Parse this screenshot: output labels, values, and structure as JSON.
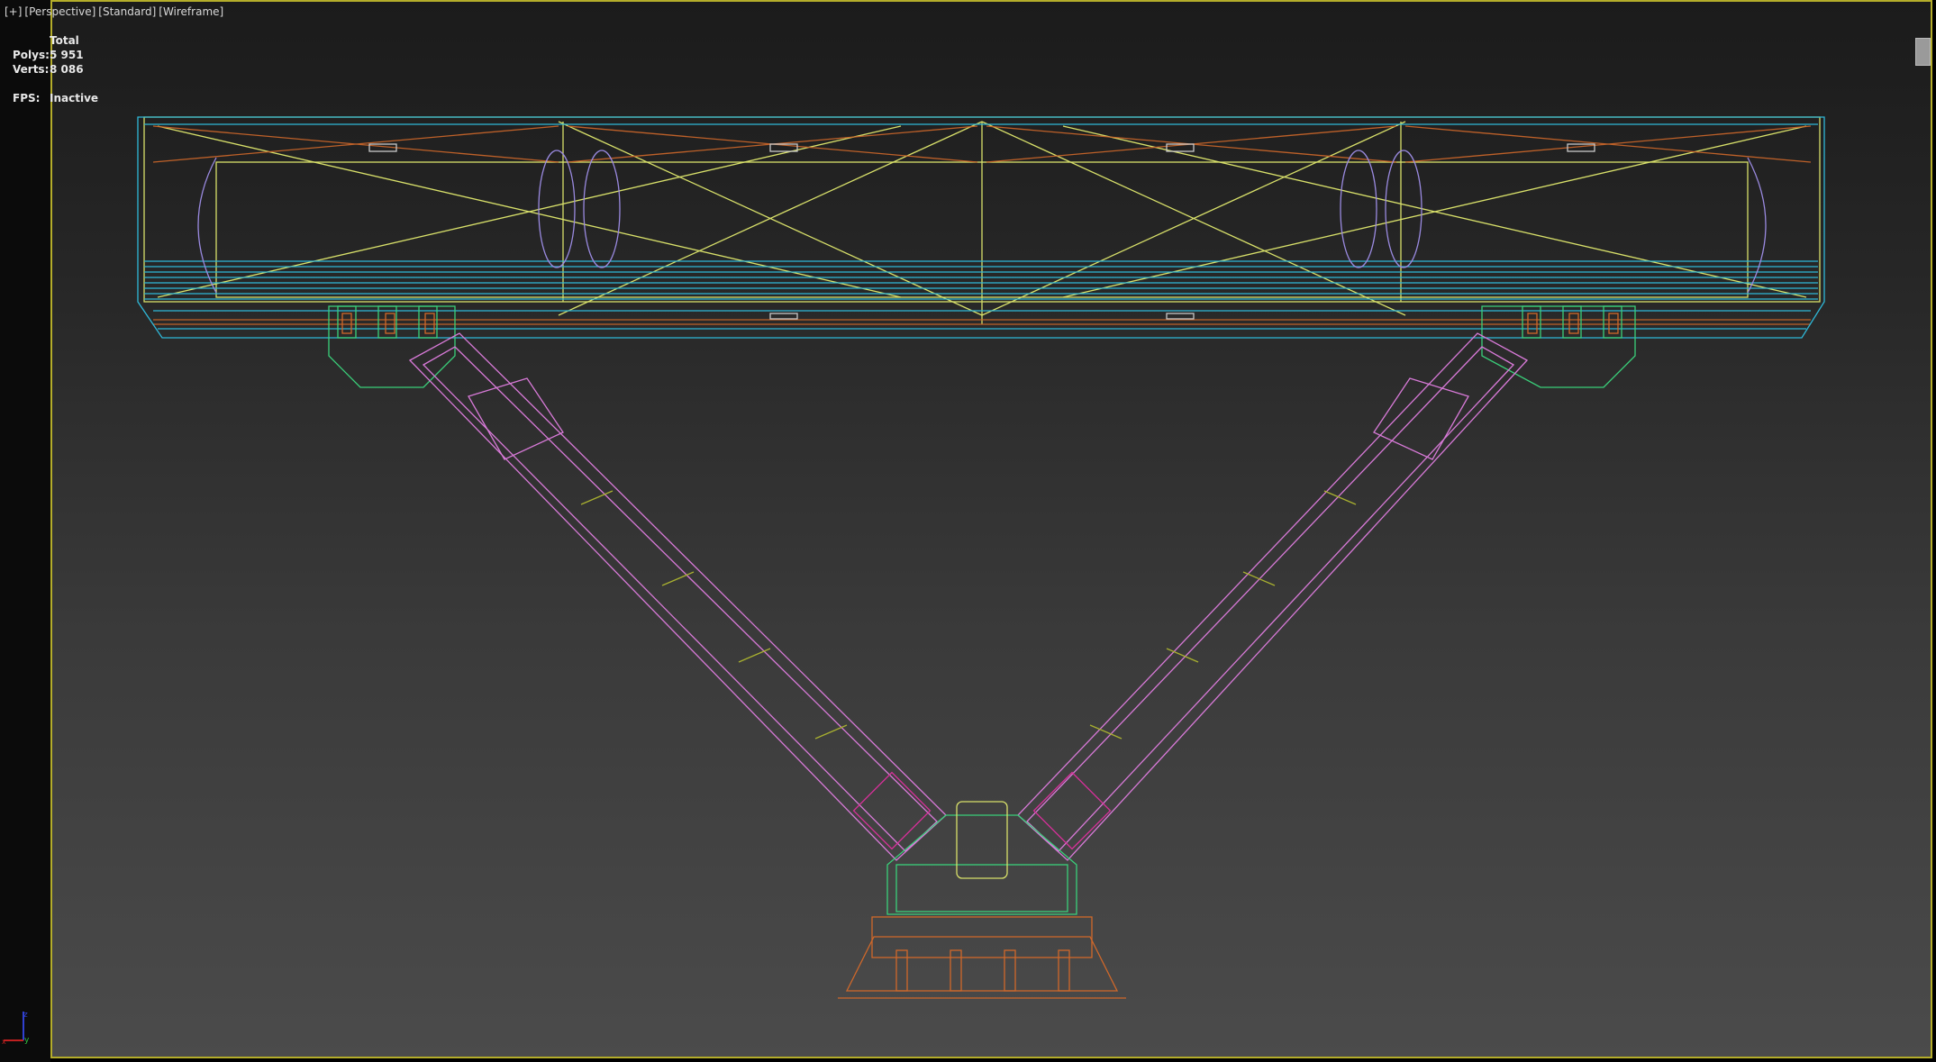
{
  "viewport": {
    "labels": [
      "[+]",
      "[Perspective]",
      "[Standard]",
      "[Wireframe]"
    ],
    "stats": {
      "header": "Total",
      "polys_label": "Polys:",
      "polys_value": "5 951",
      "verts_label": "Verts:",
      "verts_value": "8 086",
      "fps_label": "FPS:",
      "fps_value": "Inactive"
    },
    "axis_gizmo": {
      "z": "z",
      "y": "y",
      "x": "x"
    },
    "colors": {
      "border": "#b4ad2a",
      "cyan": "#2fb8d8",
      "yellow": "#d8e06a",
      "orange": "#d0682a",
      "pink": "#d87ad8",
      "green": "#3ad07a",
      "violet": "#9a8ae0"
    }
  }
}
